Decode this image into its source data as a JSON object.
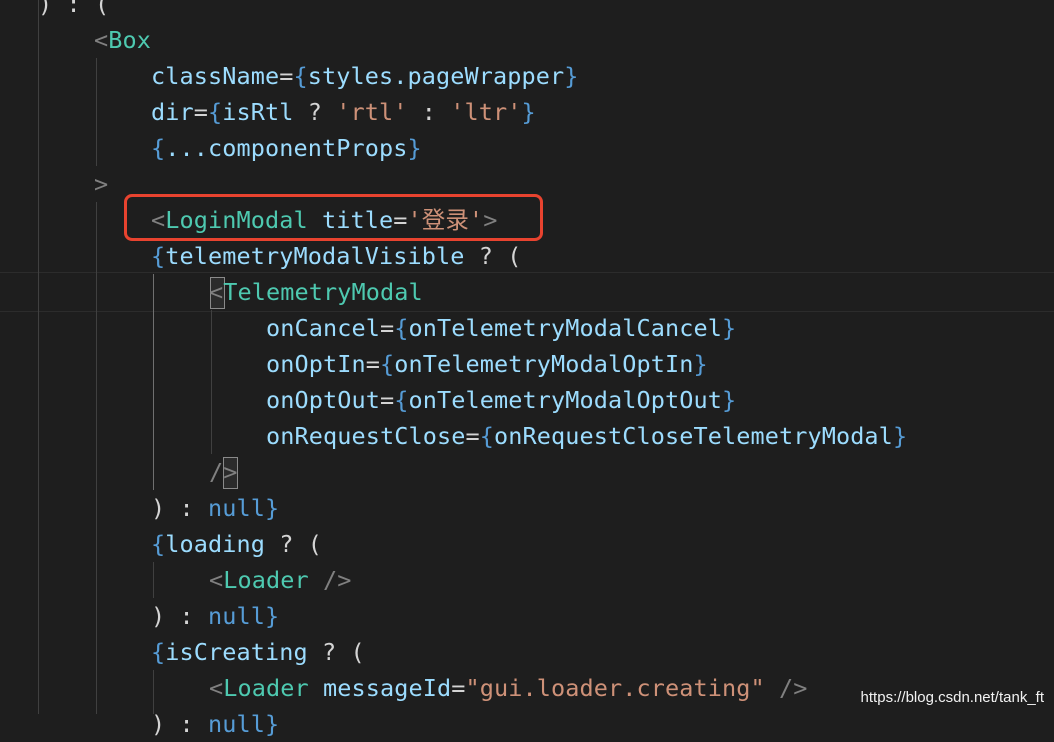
{
  "colors": {
    "background": "#1e1e1e",
    "punctuation": "#d4d4d4",
    "tag_bracket": "#808080",
    "component": "#4ec9b0",
    "attribute": "#9cdcfe",
    "variable": "#9cdcfe",
    "string": "#ce9178",
    "brace": "#569cd6",
    "keyword": "#569cd6",
    "highlight_border": "#e8432f"
  },
  "lines": [
    {
      "tokens": [
        {
          "t": ") : (",
          "c": "punctuation"
        }
      ]
    },
    {
      "tokens": [
        {
          "t": "<",
          "c": "tag_bracket"
        },
        {
          "t": "Box",
          "c": "component"
        }
      ]
    },
    {
      "tokens": [
        {
          "t": "className",
          "c": "attribute"
        },
        {
          "t": "=",
          "c": "punctuation"
        },
        {
          "t": "{",
          "c": "brace"
        },
        {
          "t": "styles.pageWrapper",
          "c": "variable"
        },
        {
          "t": "}",
          "c": "brace"
        }
      ]
    },
    {
      "tokens": [
        {
          "t": "dir",
          "c": "attribute"
        },
        {
          "t": "=",
          "c": "punctuation"
        },
        {
          "t": "{",
          "c": "brace"
        },
        {
          "t": "isRtl",
          "c": "variable"
        },
        {
          "t": " ? ",
          "c": "punctuation"
        },
        {
          "t": "'rtl'",
          "c": "string"
        },
        {
          "t": " : ",
          "c": "punctuation"
        },
        {
          "t": "'ltr'",
          "c": "string"
        },
        {
          "t": "}",
          "c": "brace"
        }
      ]
    },
    {
      "tokens": [
        {
          "t": "{",
          "c": "brace"
        },
        {
          "t": "...componentProps",
          "c": "variable"
        },
        {
          "t": "}",
          "c": "brace"
        }
      ]
    },
    {
      "tokens": [
        {
          "t": ">",
          "c": "tag_bracket"
        }
      ]
    },
    {
      "tokens": [
        {
          "t": "<",
          "c": "tag_bracket"
        },
        {
          "t": "LoginModal",
          "c": "component"
        },
        {
          "t": " ",
          "c": "punctuation"
        },
        {
          "t": "title",
          "c": "attribute"
        },
        {
          "t": "=",
          "c": "punctuation"
        },
        {
          "t": "'登录'",
          "c": "string"
        },
        {
          "t": ">",
          "c": "tag_bracket"
        }
      ]
    },
    {
      "tokens": [
        {
          "t": "{",
          "c": "brace"
        },
        {
          "t": "telemetryModalVisible",
          "c": "variable"
        },
        {
          "t": " ? (",
          "c": "punctuation"
        }
      ]
    },
    {
      "tokens": [
        {
          "t": "<",
          "c": "tag_bracket"
        },
        {
          "t": "TelemetryModal",
          "c": "component"
        }
      ]
    },
    {
      "tokens": [
        {
          "t": "onCancel",
          "c": "attribute"
        },
        {
          "t": "=",
          "c": "punctuation"
        },
        {
          "t": "{",
          "c": "brace"
        },
        {
          "t": "onTelemetryModalCancel",
          "c": "variable"
        },
        {
          "t": "}",
          "c": "brace"
        }
      ]
    },
    {
      "tokens": [
        {
          "t": "onOptIn",
          "c": "attribute"
        },
        {
          "t": "=",
          "c": "punctuation"
        },
        {
          "t": "{",
          "c": "brace"
        },
        {
          "t": "onTelemetryModalOptIn",
          "c": "variable"
        },
        {
          "t": "}",
          "c": "brace"
        }
      ]
    },
    {
      "tokens": [
        {
          "t": "onOptOut",
          "c": "attribute"
        },
        {
          "t": "=",
          "c": "punctuation"
        },
        {
          "t": "{",
          "c": "brace"
        },
        {
          "t": "onTelemetryModalOptOut",
          "c": "variable"
        },
        {
          "t": "}",
          "c": "brace"
        }
      ]
    },
    {
      "tokens": [
        {
          "t": "onRequestClose",
          "c": "attribute"
        },
        {
          "t": "=",
          "c": "punctuation"
        },
        {
          "t": "{",
          "c": "brace"
        },
        {
          "t": "onRequestCloseTelemetryModal",
          "c": "variable"
        },
        {
          "t": "}",
          "c": "brace"
        }
      ]
    },
    {
      "tokens": [
        {
          "t": "/",
          "c": "tag_bracket"
        },
        {
          "t": ">",
          "c": "tag_bracket"
        }
      ]
    },
    {
      "tokens": [
        {
          "t": ") : ",
          "c": "punctuation"
        },
        {
          "t": "null",
          "c": "keyword"
        },
        {
          "t": "}",
          "c": "brace"
        }
      ]
    },
    {
      "tokens": [
        {
          "t": "{",
          "c": "brace"
        },
        {
          "t": "loading",
          "c": "variable"
        },
        {
          "t": " ? (",
          "c": "punctuation"
        }
      ]
    },
    {
      "tokens": [
        {
          "t": "<",
          "c": "tag_bracket"
        },
        {
          "t": "Loader",
          "c": "component"
        },
        {
          "t": " />",
          "c": "tag_bracket"
        }
      ]
    },
    {
      "tokens": [
        {
          "t": ") : ",
          "c": "punctuation"
        },
        {
          "t": "null",
          "c": "keyword"
        },
        {
          "t": "}",
          "c": "brace"
        }
      ]
    },
    {
      "tokens": [
        {
          "t": "{",
          "c": "brace"
        },
        {
          "t": "isCreating",
          "c": "variable"
        },
        {
          "t": " ? (",
          "c": "punctuation"
        }
      ]
    },
    {
      "tokens": [
        {
          "t": "<",
          "c": "tag_bracket"
        },
        {
          "t": "Loader",
          "c": "component"
        },
        {
          "t": " ",
          "c": "punctuation"
        },
        {
          "t": "messageId",
          "c": "attribute"
        },
        {
          "t": "=",
          "c": "punctuation"
        },
        {
          "t": "\"gui.loader.creating\"",
          "c": "string"
        },
        {
          "t": " />",
          "c": "tag_bracket"
        }
      ]
    },
    {
      "tokens": [
        {
          "t": ") : ",
          "c": "punctuation"
        },
        {
          "t": "null",
          "c": "keyword"
        },
        {
          "t": "}",
          "c": "brace"
        }
      ]
    }
  ],
  "watermark": "https://blog.csdn.net/tank_ft"
}
